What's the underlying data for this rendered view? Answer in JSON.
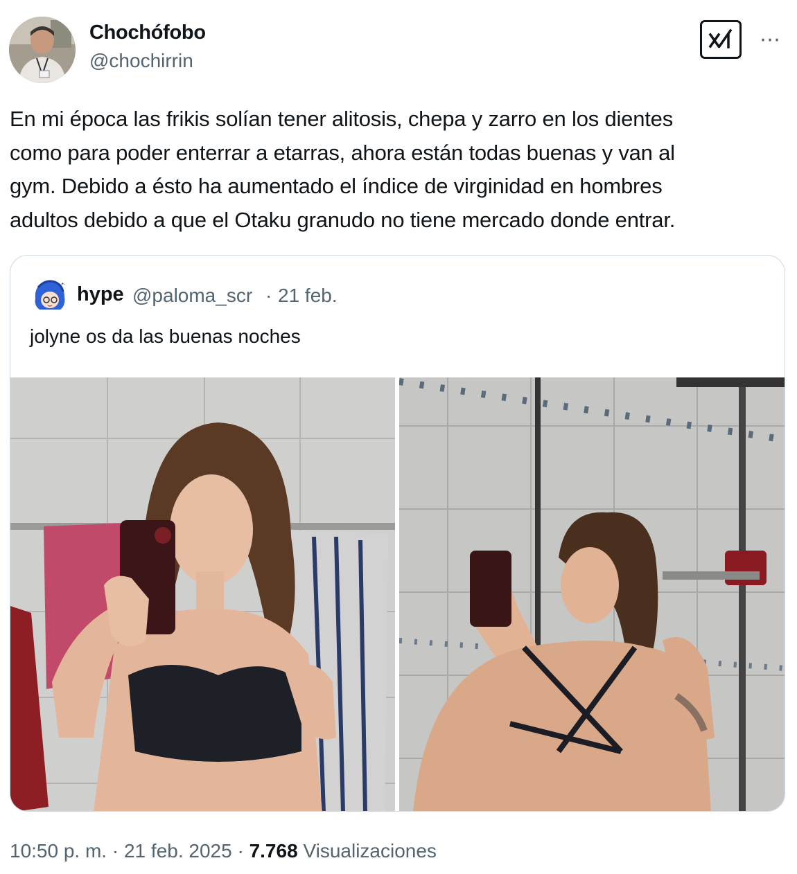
{
  "author": {
    "name": "Chochófobo",
    "handle": "@chochirrin"
  },
  "header_icons": {
    "grok_button": "grok-xai-icon",
    "more": "⋯"
  },
  "tweet": {
    "text": "En mi época las frikis solían tener alitosis, chepa y zarro en los dientes\ncomo para poder enterrar a etarras, ahora están todas buenas y van al\ngym. Debido a ésto ha aumentado el índice de virginidad en hombres\nadultos debido a que el Otaku granudo no tiene mercado donde entrar."
  },
  "quoted_tweet": {
    "name": "hype",
    "handle": "@paloma_scr",
    "separator": "·",
    "date": "21 feb.",
    "text": "jolyne os da las buenas noches",
    "media_count": 2
  },
  "footer": {
    "time": "10:50 p. m.",
    "sep1": "·",
    "date": "21 feb. 2025",
    "sep2": "·",
    "views_count": "7.768",
    "views_label": "Visualizaciones"
  },
  "colors": {
    "text": "#0f1419",
    "secondary": "#536471",
    "border": "#cfd9de"
  }
}
